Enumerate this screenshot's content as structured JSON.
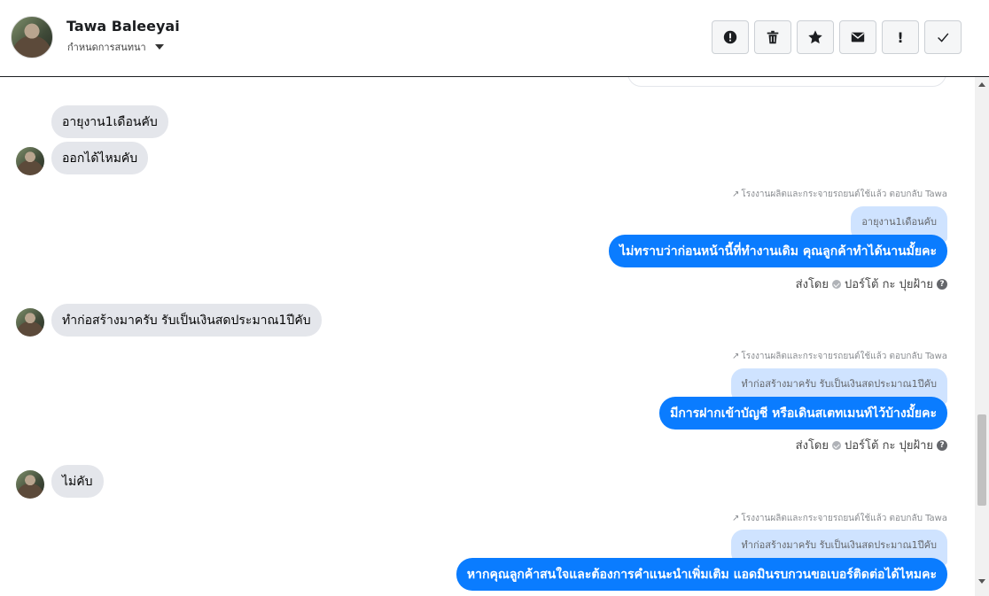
{
  "contact": {
    "name": "Tawa Baleeyai",
    "subtitle": "กำหนดการสนทนา"
  },
  "toolbar": {
    "buttons": [
      {
        "name": "report-button",
        "icon": "alert-circle-icon",
        "label": ""
      },
      {
        "name": "delete-button",
        "icon": "trash-icon",
        "label": ""
      },
      {
        "name": "star-button",
        "icon": "star-icon",
        "label": ""
      },
      {
        "name": "mark-unread-button",
        "icon": "envelope-icon",
        "label": ""
      },
      {
        "name": "priority-button",
        "icon": "exclamation-icon",
        "label": "!"
      },
      {
        "name": "done-button",
        "icon": "check-icon",
        "label": ""
      }
    ]
  },
  "messages": {
    "in1": "อายุงาน1เดือนคับ",
    "in2": "ออกได้ไหมคับ",
    "in3": "ทำก่อสร้างมาครับ รับเป็นเงินสดประมาณ1ปีคับ",
    "in4": "ไม่คับ",
    "reply_meta": "โรงงานผลิตและกระจายรถยนต์ใช้แล้ว ตอบกลับ Tawa",
    "quote1": "อายุงาน1เดือนคับ",
    "out1": "ไม่ทราบว่าก่อนหน้านี้ที่ทำงานเดิม คุณลูกค้าทำได้นานมั้ยคะ",
    "quote2": "ทำก่อสร้างมาครับ รับเป็นเงินสดประมาณ1ปีคับ",
    "out2": "มีการฝากเข้าบัญชี หรือเดินสเตทเมนท์ไว้บ้างมั้ยคะ",
    "quote3": "ทำก่อสร้างมาครับ รับเป็นเงินสดประมาณ1ปีคับ",
    "out3": "หากคุณลูกค้าสนใจและต้องการคำแนะนำเพิ่มเติม แอดมินรบกวนขอเบอร์ติดต่อได้ไหมคะ",
    "sent_by_label": "ส่งโดย",
    "sent_by_name": "ปอร์โต้ กะ ปุยฝ้าย"
  },
  "colors": {
    "outgoing": "#0a7cff",
    "incoming": "#e4e6eb",
    "quote": "#cfe3ff"
  }
}
